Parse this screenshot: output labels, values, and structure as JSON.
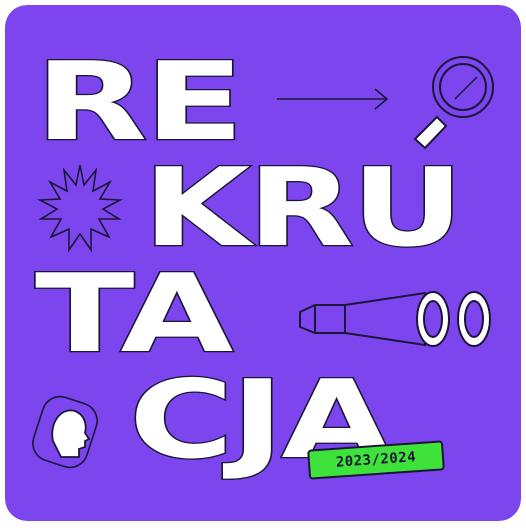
{
  "poster": {
    "title_lines": [
      "RE",
      "KRU",
      "TA",
      "CJA"
    ],
    "year_badge": "2023/2024"
  },
  "colors": {
    "background": "#7c45ee",
    "text_fill": "#ffffff",
    "outline": "#1a1638",
    "badge": "#3fe23a"
  },
  "icons": [
    "arrow-right-icon",
    "magnifier-icon",
    "starburst-icon",
    "binoculars-icon",
    "head-profile-icon"
  ]
}
